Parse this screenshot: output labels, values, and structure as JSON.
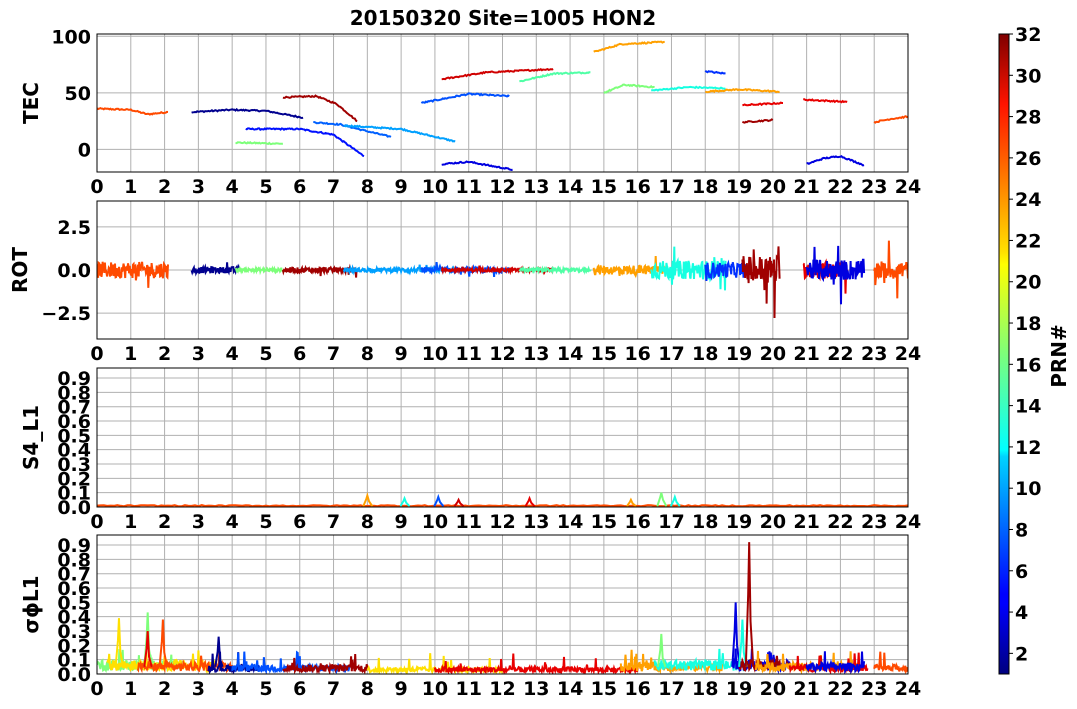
{
  "title": "20150320 Site=1005 HON2",
  "chart_data": [
    {
      "type": "line",
      "panel": "TEC",
      "ylabel": "TEC",
      "xlim": [
        0,
        24
      ],
      "ylim": [
        -20,
        102
      ],
      "yticks": [
        0,
        50,
        100
      ],
      "xticks": [
        0,
        1,
        2,
        3,
        4,
        5,
        6,
        7,
        8,
        9,
        10,
        11,
        12,
        13,
        14,
        15,
        16,
        17,
        18,
        19,
        20,
        21,
        22,
        23,
        24
      ],
      "grid": true,
      "series": [
        {
          "prn": 26,
          "color": "#ff4a00",
          "x": [
            0,
            1.0,
            1.5,
            2.1
          ],
          "y": [
            36,
            35,
            31,
            33
          ]
        },
        {
          "prn": 2,
          "color": "#00008f",
          "x": [
            2.8,
            4,
            5,
            6.1
          ],
          "y": [
            33,
            35,
            34,
            28
          ]
        },
        {
          "prn": 17,
          "color": "#7dff7a",
          "x": [
            4.1,
            5.5
          ],
          "y": [
            6,
            5
          ]
        },
        {
          "prn": 4,
          "color": "#0010ff",
          "x": [
            4.4,
            6.0,
            7.0,
            7.9
          ],
          "y": [
            18,
            18,
            13,
            -6
          ]
        },
        {
          "prn": 31,
          "color": "#a00000",
          "x": [
            5.5,
            6.5,
            7.1,
            7.7
          ],
          "y": [
            46,
            47,
            40,
            25
          ]
        },
        {
          "prn": 9,
          "color": "#0060ff",
          "x": [
            6.4,
            7.2,
            8.0,
            8.7
          ],
          "y": [
            24,
            22,
            16,
            11
          ]
        },
        {
          "prn": 11,
          "color": "#00a0ff",
          "x": [
            7.3,
            9.0,
            10.6
          ],
          "y": [
            21,
            18,
            7
          ]
        },
        {
          "prn": 8,
          "color": "#0050ff",
          "x": [
            9.6,
            11.0,
            12.2
          ],
          "y": [
            41,
            49,
            47
          ]
        },
        {
          "prn": 30,
          "color": "#d00000",
          "x": [
            10.2,
            11.5,
            13.5
          ],
          "y": [
            62,
            68,
            71
          ]
        },
        {
          "prn": 15,
          "color": "#50ffa6",
          "x": [
            12.5,
            13.5,
            14.6
          ],
          "y": [
            60,
            67,
            68
          ]
        },
        {
          "prn": 5,
          "color": "#0000e0",
          "x": [
            10.2,
            11.0,
            12.3
          ],
          "y": [
            -13,
            -11,
            -18
          ]
        },
        {
          "prn": 24,
          "color": "#ffa000",
          "x": [
            14.7,
            15.5,
            16.8
          ],
          "y": [
            86,
            93,
            95
          ]
        },
        {
          "prn": 17,
          "color": "#7dff7a",
          "x": [
            15.0,
            15.6,
            16.5
          ],
          "y": [
            50,
            57,
            55
          ]
        },
        {
          "prn": 13,
          "color": "#16ffe1",
          "x": [
            16.4,
            17.5,
            18.6
          ],
          "y": [
            52,
            55,
            54
          ]
        },
        {
          "prn": 7,
          "color": "#0030ff",
          "x": [
            18.0,
            18.6
          ],
          "y": [
            69,
            67
          ]
        },
        {
          "prn": 24,
          "color": "#ffa000",
          "x": [
            18.0,
            19.0,
            20.2
          ],
          "y": [
            51,
            53,
            51
          ]
        },
        {
          "prn": 28,
          "color": "#e80000",
          "x": [
            19.1,
            20.3
          ],
          "y": [
            39,
            41
          ]
        },
        {
          "prn": 31,
          "color": "#a00000",
          "x": [
            19.1,
            20.0
          ],
          "y": [
            24,
            26
          ]
        },
        {
          "prn": 28,
          "color": "#e80000",
          "x": [
            20.9,
            22.2
          ],
          "y": [
            44,
            42
          ]
        },
        {
          "prn": 5,
          "color": "#0000e0",
          "x": [
            21.0,
            21.5,
            22.0,
            22.7
          ],
          "y": [
            -13,
            -8,
            -6,
            -14
          ]
        },
        {
          "prn": 26,
          "color": "#ff4a00",
          "x": [
            23.0,
            23.5,
            24.0
          ],
          "y": [
            24,
            27,
            29
          ]
        }
      ]
    },
    {
      "type": "line",
      "panel": "ROT",
      "ylabel": "ROT",
      "xlim": [
        0,
        24
      ],
      "ylim": [
        -4,
        4
      ],
      "yticks": [
        -2.5,
        0.0,
        2.5
      ],
      "ytick_labels": [
        "−2.5",
        "0.0",
        "2.5"
      ],
      "xticks": [
        0,
        1,
        2,
        3,
        4,
        5,
        6,
        7,
        8,
        9,
        10,
        11,
        12,
        13,
        14,
        15,
        16,
        17,
        18,
        19,
        20,
        21,
        22,
        23,
        24
      ],
      "grid": true,
      "segments": [
        {
          "prn": 26,
          "color": "#ff4a00",
          "x0": 0.0,
          "x1": 2.1,
          "amp": 1.6
        },
        {
          "prn": 2,
          "color": "#00008f",
          "x0": 2.8,
          "x1": 4.2,
          "amp": 0.6
        },
        {
          "prn": 17,
          "color": "#7dff7a",
          "x0": 4.1,
          "x1": 5.5,
          "amp": 0.3
        },
        {
          "prn": 31,
          "color": "#a00000",
          "x0": 5.5,
          "x1": 7.7,
          "amp": 0.5
        },
        {
          "prn": 11,
          "color": "#00a0ff",
          "x0": 7.3,
          "x1": 10.6,
          "amp": 0.4
        },
        {
          "prn": 8,
          "color": "#0050ff",
          "x0": 9.6,
          "x1": 12.2,
          "amp": 0.5
        },
        {
          "prn": 30,
          "color": "#d00000",
          "x0": 10.2,
          "x1": 13.5,
          "amp": 0.3
        },
        {
          "prn": 15,
          "color": "#50ffa6",
          "x0": 12.5,
          "x1": 14.6,
          "amp": 0.3
        },
        {
          "prn": 24,
          "color": "#ffa000",
          "x0": 14.7,
          "x1": 16.8,
          "amp": 0.9
        },
        {
          "prn": 13,
          "color": "#16ffe1",
          "x0": 16.4,
          "x1": 18.6,
          "amp": 1.8
        },
        {
          "prn": 7,
          "color": "#0030ff",
          "x0": 18.0,
          "x1": 19.2,
          "amp": 1.5
        },
        {
          "prn": 31,
          "color": "#a00000",
          "x0": 19.1,
          "x1": 20.2,
          "amp": 2.8
        },
        {
          "prn": 28,
          "color": "#e80000",
          "x0": 20.9,
          "x1": 22.2,
          "amp": 1.6
        },
        {
          "prn": 5,
          "color": "#0000e0",
          "x0": 21.0,
          "x1": 22.7,
          "amp": 2.0
        },
        {
          "prn": 26,
          "color": "#ff4a00",
          "x0": 23.0,
          "x1": 24.0,
          "amp": 1.8
        }
      ]
    },
    {
      "type": "line",
      "panel": "S4_L1",
      "ylabel": "S4_L1",
      "xlim": [
        0,
        24
      ],
      "ylim": [
        0,
        0.97
      ],
      "yticks": [
        0.0,
        0.1,
        0.2,
        0.3,
        0.4,
        0.5,
        0.6,
        0.7,
        0.8,
        0.9
      ],
      "ytick_labels": [
        "0.0",
        "0.1",
        "0.2",
        "0.3",
        "0.4",
        "0.5",
        "0.6",
        "0.7",
        "0.8",
        "0.9"
      ],
      "xticks": [
        0,
        1,
        2,
        3,
        4,
        5,
        6,
        7,
        8,
        9,
        10,
        11,
        12,
        13,
        14,
        15,
        16,
        17,
        18,
        19,
        20,
        21,
        22,
        23,
        24
      ],
      "grid": true,
      "spikes": [
        {
          "color": "#ffa000",
          "x": 8.0,
          "y": 0.08
        },
        {
          "color": "#16ffe1",
          "x": 9.1,
          "y": 0.06
        },
        {
          "color": "#0050ff",
          "x": 10.1,
          "y": 0.07
        },
        {
          "color": "#d00000",
          "x": 10.7,
          "y": 0.05
        },
        {
          "color": "#e80000",
          "x": 12.8,
          "y": 0.06
        },
        {
          "color": "#ffa000",
          "x": 15.8,
          "y": 0.05
        },
        {
          "color": "#7dff7a",
          "x": 16.7,
          "y": 0.1
        },
        {
          "color": "#16ffe1",
          "x": 17.1,
          "y": 0.07
        }
      ]
    },
    {
      "type": "line",
      "panel": "sigma_phi_L1",
      "ylabel": "σϕL1",
      "xlim": [
        0,
        24
      ],
      "ylim": [
        0,
        0.97
      ],
      "yticks": [
        0.0,
        0.1,
        0.2,
        0.3,
        0.4,
        0.5,
        0.6,
        0.7,
        0.8,
        0.9
      ],
      "ytick_labels": [
        "0.0",
        "0.1",
        "0.2",
        "0.3",
        "0.4",
        "0.5",
        "0.6",
        "0.7",
        "0.8",
        "0.9"
      ],
      "xticks": [
        0,
        1,
        2,
        3,
        4,
        5,
        6,
        7,
        8,
        9,
        10,
        11,
        12,
        13,
        14,
        15,
        16,
        17,
        18,
        19,
        20,
        21,
        22,
        23,
        24
      ],
      "grid": true,
      "segments": [
        {
          "color": "#7dff7a",
          "x0": 0.0,
          "x1": 2.5,
          "base": 0.06
        },
        {
          "color": "#ffe000",
          "x0": 0.3,
          "x1": 3.5,
          "base": 0.06
        },
        {
          "color": "#ff4a00",
          "x0": 1.2,
          "x1": 4.0,
          "base": 0.05
        },
        {
          "color": "#00008f",
          "x0": 3.3,
          "x1": 4.8,
          "base": 0.04
        },
        {
          "color": "#0050ff",
          "x0": 4.0,
          "x1": 7.5,
          "base": 0.04
        },
        {
          "color": "#a00000",
          "x0": 5.5,
          "x1": 8.0,
          "base": 0.04
        },
        {
          "color": "#ffe000",
          "x0": 8.0,
          "x1": 12.0,
          "base": 0.03
        },
        {
          "color": "#e80000",
          "x0": 10.0,
          "x1": 16.0,
          "base": 0.03
        },
        {
          "color": "#ffa000",
          "x0": 15.5,
          "x1": 18.5,
          "base": 0.05
        },
        {
          "color": "#16ffe1",
          "x0": 16.5,
          "x1": 19.2,
          "base": 0.06
        },
        {
          "color": "#0000e0",
          "x0": 18.8,
          "x1": 20.5,
          "base": 0.06
        },
        {
          "color": "#a00000",
          "x0": 19.0,
          "x1": 20.5,
          "base": 0.06
        },
        {
          "color": "#ffa000",
          "x0": 19.5,
          "x1": 22.5,
          "base": 0.05
        },
        {
          "color": "#e80000",
          "x0": 20.5,
          "x1": 22.8,
          "base": 0.04
        },
        {
          "color": "#0000e0",
          "x0": 21.0,
          "x1": 22.7,
          "base": 0.05
        },
        {
          "color": "#ff4a00",
          "x0": 23.0,
          "x1": 24.0,
          "base": 0.04
        }
      ],
      "spikes": [
        {
          "color": "#ffe000",
          "x": 0.65,
          "y": 0.39
        },
        {
          "color": "#7dff7a",
          "x": 1.5,
          "y": 0.43
        },
        {
          "color": "#ff4a00",
          "x": 1.95,
          "y": 0.38
        },
        {
          "color": "#e80000",
          "x": 1.5,
          "y": 0.3
        },
        {
          "color": "#00008f",
          "x": 3.6,
          "y": 0.26
        },
        {
          "color": "#7dff7a",
          "x": 16.7,
          "y": 0.28
        },
        {
          "color": "#0000e0",
          "x": 18.9,
          "y": 0.5
        },
        {
          "color": "#16ffe1",
          "x": 19.1,
          "y": 0.38
        },
        {
          "color": "#a00000",
          "x": 19.3,
          "y": 0.92
        }
      ]
    }
  ],
  "colorbar": {
    "label": "PRN#",
    "min": 1,
    "max": 32,
    "ticks": [
      2,
      4,
      6,
      8,
      10,
      12,
      14,
      16,
      18,
      20,
      22,
      24,
      26,
      28,
      30,
      32
    ],
    "colormap": "jet"
  }
}
